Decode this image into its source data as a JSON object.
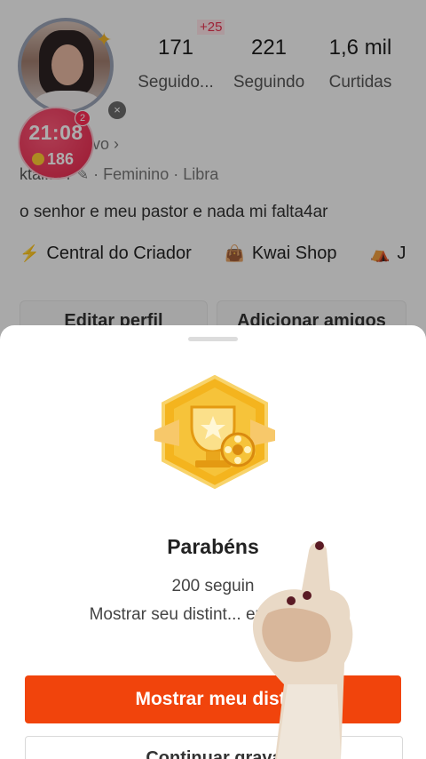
{
  "profile": {
    "new_followers_badge": "+25",
    "stats": [
      {
        "value": "171",
        "label": "Seguido..."
      },
      {
        "value": "221",
        "label": "Seguindo"
      },
      {
        "value": "1,6 mil",
        "label": "Curtidas"
      }
    ],
    "live_badge": {
      "time": "21:08",
      "coins": "186",
      "notification_count": "2"
    },
    "status_text": "ivo ›",
    "username": "ktal..54",
    "gender": "Feminino",
    "sign": "Libra",
    "bio": "o senhor e meu pastor e nada mi falta4ar",
    "links": [
      {
        "label": "Central do Criador",
        "icon": "lightning-circle-icon"
      },
      {
        "label": "Kwai Shop",
        "icon": "shopping-bag-icon"
      },
      {
        "label": "J",
        "icon": "tent-icon"
      }
    ],
    "buttons": {
      "edit": "Editar perfil",
      "add_friends": "Adicionar amigos"
    }
  },
  "sheet": {
    "title": "Parabéns",
    "subtitle": "200 seguin",
    "message": "Mostrar seu distint... eus amigos!",
    "primary_button": "Mostrar meu disti",
    "secondary_button": "Continuar grava"
  },
  "colors": {
    "accent": "#f1440c",
    "live_badge": "#e6244a",
    "badge_gold": "#f4b41e"
  }
}
